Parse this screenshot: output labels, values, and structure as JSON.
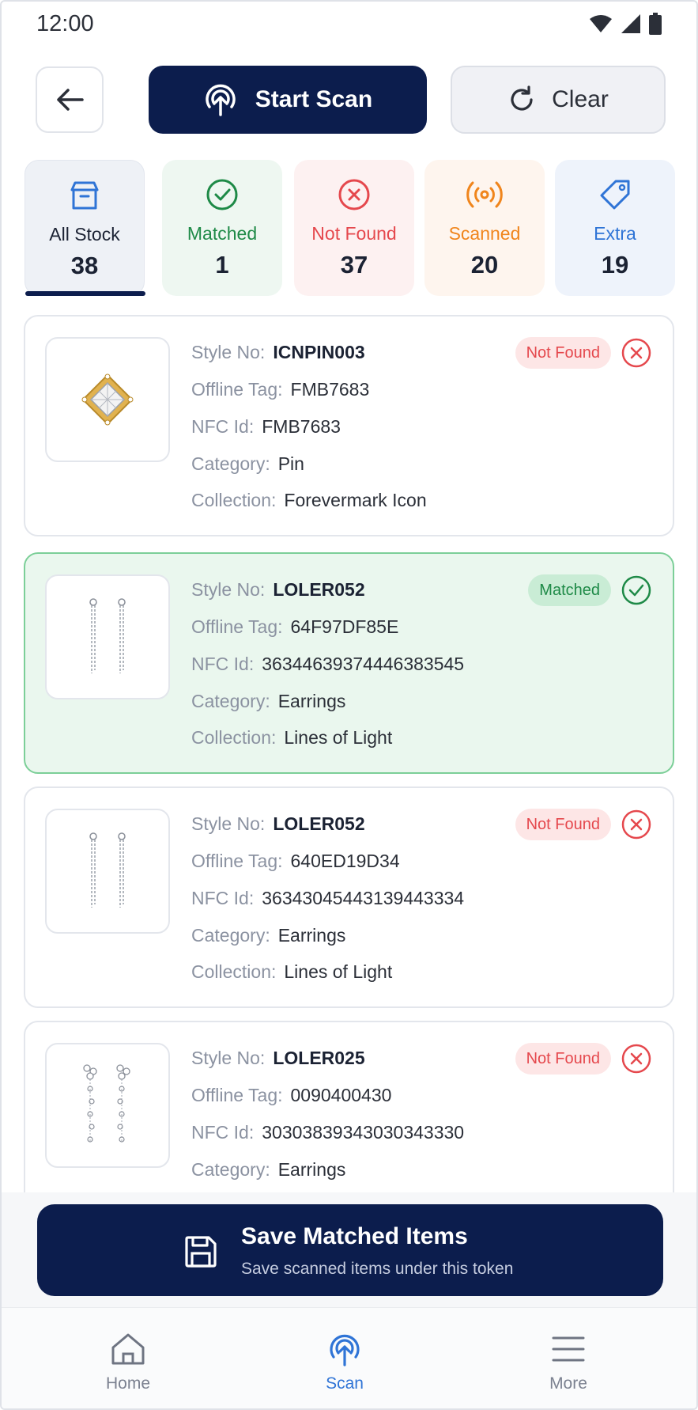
{
  "status_bar": {
    "time": "12:00"
  },
  "header": {
    "start_scan_label": "Start Scan",
    "clear_label": "Clear"
  },
  "stats": [
    {
      "label": "All Stock",
      "count": "38",
      "icon": "box-icon",
      "color": "#2f74d6"
    },
    {
      "label": "Matched",
      "count": "1",
      "icon": "check-circle-icon",
      "color": "#1e8a47"
    },
    {
      "label": "Not Found",
      "count": "37",
      "icon": "x-circle-icon",
      "color": "#e5484d"
    },
    {
      "label": "Scanned",
      "count": "20",
      "icon": "broadcast-icon",
      "color": "#f0851c"
    },
    {
      "label": "Extra",
      "count": "19",
      "icon": "tag-icon",
      "color": "#2f74d6"
    }
  ],
  "field_labels": {
    "style_no": "Style No:",
    "offline_tag": "Offline Tag:",
    "nfc_id": "NFC Id:",
    "category": "Category:",
    "collection": "Collection:"
  },
  "items": [
    {
      "style_no": "ICNPIN003",
      "offline_tag": "FMB7683",
      "nfc_id": "FMB7683",
      "category": "Pin",
      "collection": "Forevermark Icon",
      "status": "Not Found"
    },
    {
      "style_no": "LOLER052",
      "offline_tag": "64F97DF85E",
      "nfc_id": "36344639374446383545",
      "category": "Earrings",
      "collection": "Lines of Light",
      "status": "Matched"
    },
    {
      "style_no": "LOLER052",
      "offline_tag": "640ED19D34",
      "nfc_id": "36343045443139443334",
      "category": "Earrings",
      "collection": "Lines of Light",
      "status": "Not Found"
    },
    {
      "style_no": "LOLER025",
      "offline_tag": "0090400430",
      "nfc_id": "30303839343030343330",
      "category": "Earrings",
      "status": "Not Found"
    }
  ],
  "save_bar": {
    "title": "Save Matched Items",
    "subtitle": "Save scanned items under this token"
  },
  "bottom_nav": [
    {
      "label": "Home",
      "icon": "home-icon"
    },
    {
      "label": "Scan",
      "icon": "scan-icon"
    },
    {
      "label": "More",
      "icon": "menu-icon"
    }
  ]
}
